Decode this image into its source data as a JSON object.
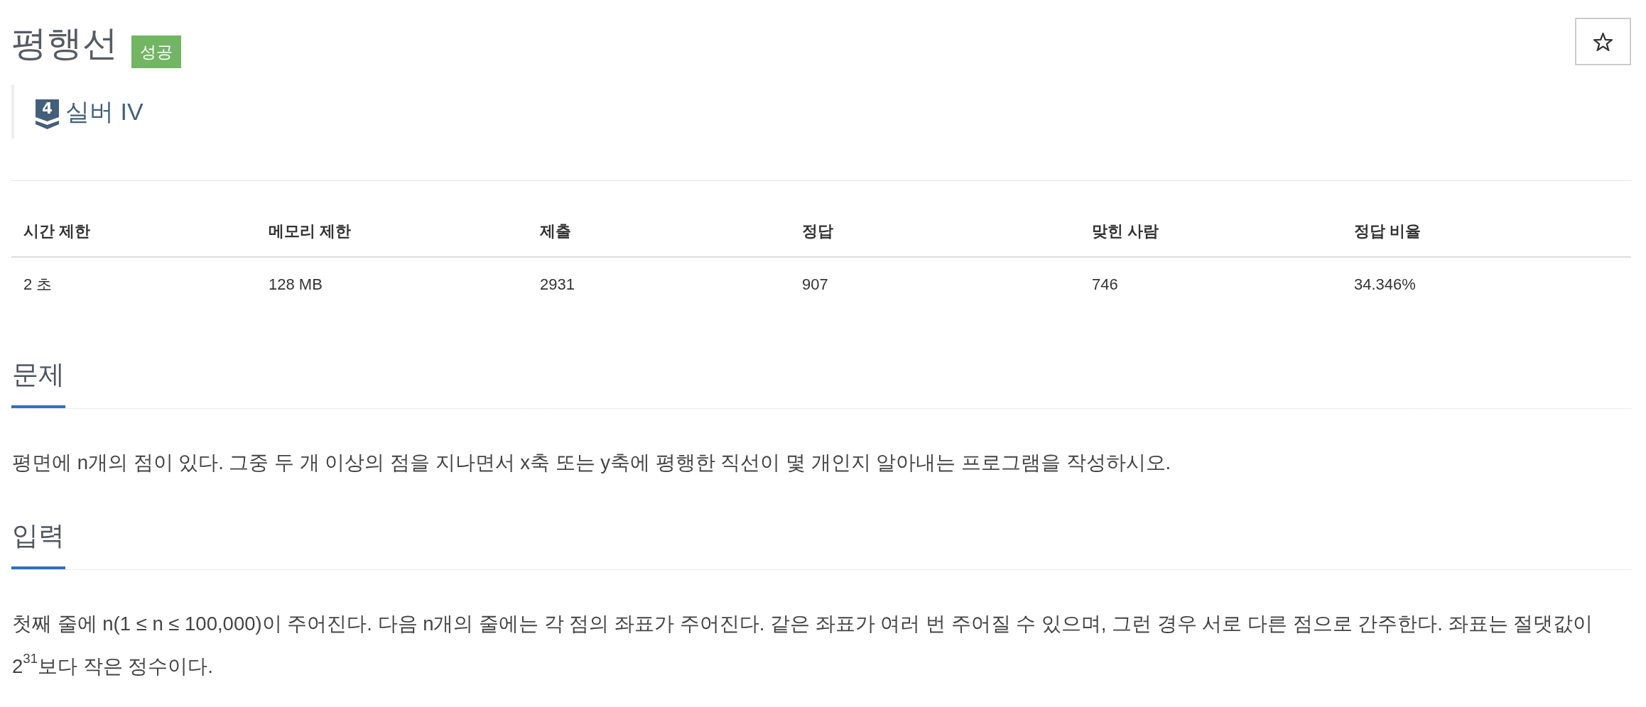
{
  "header": {
    "title": "평행선",
    "result_badge": "성공",
    "favorite": {
      "starred": false
    },
    "tier": {
      "emblem": "4",
      "label": "실버 IV"
    }
  },
  "info_table": {
    "columns": [
      "시간 제한",
      "메모리 제한",
      "제출",
      "정답",
      "맞힌 사람",
      "정답 비율"
    ],
    "rows": [
      [
        "2 초",
        "128 MB",
        "2931",
        "907",
        "746",
        "34.346%"
      ]
    ]
  },
  "sections": [
    {
      "heading": "문제",
      "paragraphs": [
        "평면에 n개의 점이 있다. 그중 두 개 이상의 점을 지나면서 x축 또는 y축에 평행한 직선이 몇 개인지 알아내는 프로그램을 작성하시오."
      ]
    },
    {
      "heading": "입력",
      "paragraphs": [
        "첫째 줄에 n(1 ≤ n ≤ 100,000)이 주어진다. 다음 n개의 줄에는 각 점의 좌표가 주어진다. 같은 좌표가 여러 번 주어질 수 있으며, 그런 경우 서로 다른 점으로 간주한다. 좌표는 절댓값이 2$^{31}$보다 작은 정수이다."
      ]
    }
  ]
}
